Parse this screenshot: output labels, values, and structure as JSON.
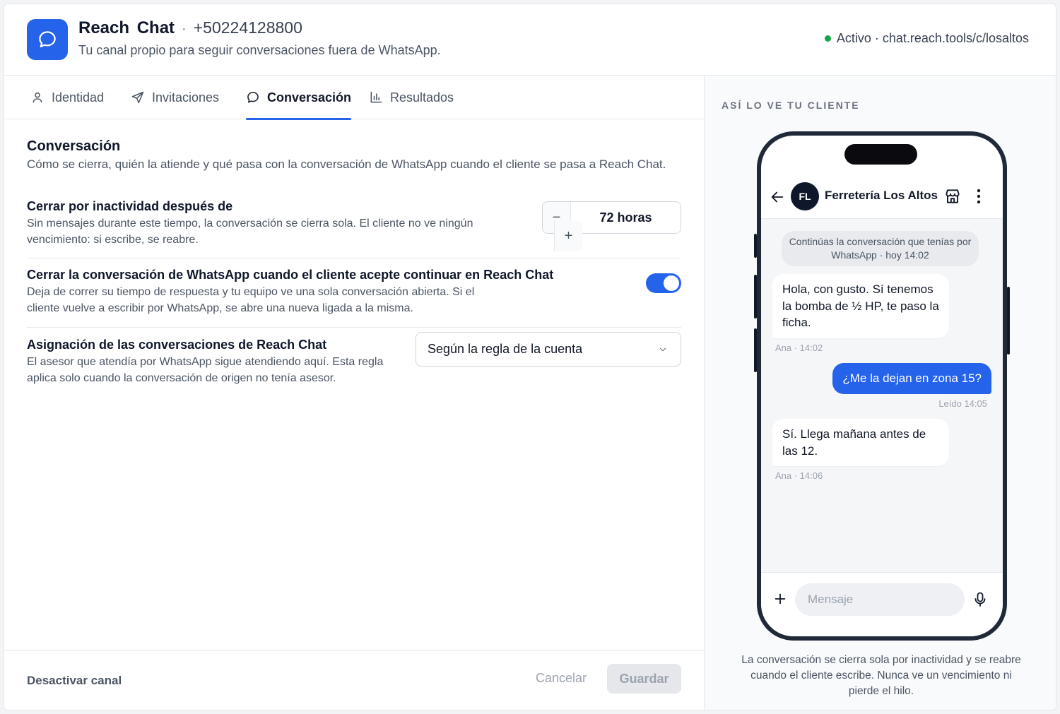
{
  "header": {
    "title": "Reach Chat",
    "separator": "·",
    "phone": "+50224128800",
    "subtitle": "Tu canal propio para seguir conversaciones fuera de WhatsApp.",
    "status": "Activo · chat.reach.tools/c/losaltos",
    "status_color": "#16a34a",
    "logo_icon": "chat-bubble-icon"
  },
  "tabs": [
    {
      "label": "Identidad",
      "icon": "user-icon"
    },
    {
      "label": "Invitaciones",
      "icon": "send-icon"
    },
    {
      "label": "Conversación",
      "icon": "chat-bubble-icon",
      "active": true
    },
    {
      "label": "Resultados",
      "icon": "bar-chart-icon"
    }
  ],
  "section": {
    "title": "Conversación",
    "description": "Cómo se cierra, quién la atiende y qué pasa con la conversación de WhatsApp cuando el cliente se pasa a Reach Chat."
  },
  "settings": {
    "inactivity": {
      "title": "Cerrar por inactividad después de",
      "description": "Sin mensajes durante este tiempo, la conversación se cierra sola. El cliente no ve ningún vencimiento: si escribe, se reabre.",
      "value": "72 horas",
      "minus": "−",
      "plus": "+"
    },
    "close_whatsapp": {
      "title": "Cerrar la conversación de WhatsApp cuando el cliente acepte continuar en Reach Chat",
      "description": "Deja de correr su tiempo de respuesta y tu equipo ve una sola conversación abierta. Si el cliente vuelve a escribir por WhatsApp, se abre una nueva ligada a la misma.",
      "enabled": true
    },
    "assignment": {
      "title": "Asignación de las conversaciones de Reach Chat",
      "description": "El asesor que atendía por WhatsApp sigue atendiendo aquí. Esta regla aplica solo cuando la conversación de origen no tenía asesor.",
      "selected": "Según la regla de la cuenta"
    }
  },
  "footer": {
    "deactivate": "Desactivar canal",
    "cancel": "Cancelar",
    "save": "Guardar"
  },
  "preview": {
    "label": "ASÍ LO VE TU CLIENTE",
    "contact_initials": "FL",
    "contact_name": "Ferretería Los Altos",
    "system_message": "Continúas la conversación que tenías por WhatsApp · hoy 14:02",
    "messages": [
      {
        "direction": "in",
        "text": "Hola, con gusto. Sí tenemos la bomba de ½ HP, te paso la ficha.",
        "meta": "Ana · 14:02"
      },
      {
        "direction": "out",
        "text": "¿Me la dejan en zona 15?",
        "meta": "Leído 14:05"
      },
      {
        "direction": "in",
        "text": "Sí. Llega mañana antes de las 12.",
        "meta": "Ana · 14:06"
      }
    ],
    "input_placeholder": "Mensaje",
    "caption": "La conversación se cierra sola por inactividad y se reabre cuando el cliente escribe. Nunca ve un vencimiento ni pierde el hilo."
  },
  "colors": {
    "accent": "#2563eb",
    "dark": "#0f172a"
  }
}
